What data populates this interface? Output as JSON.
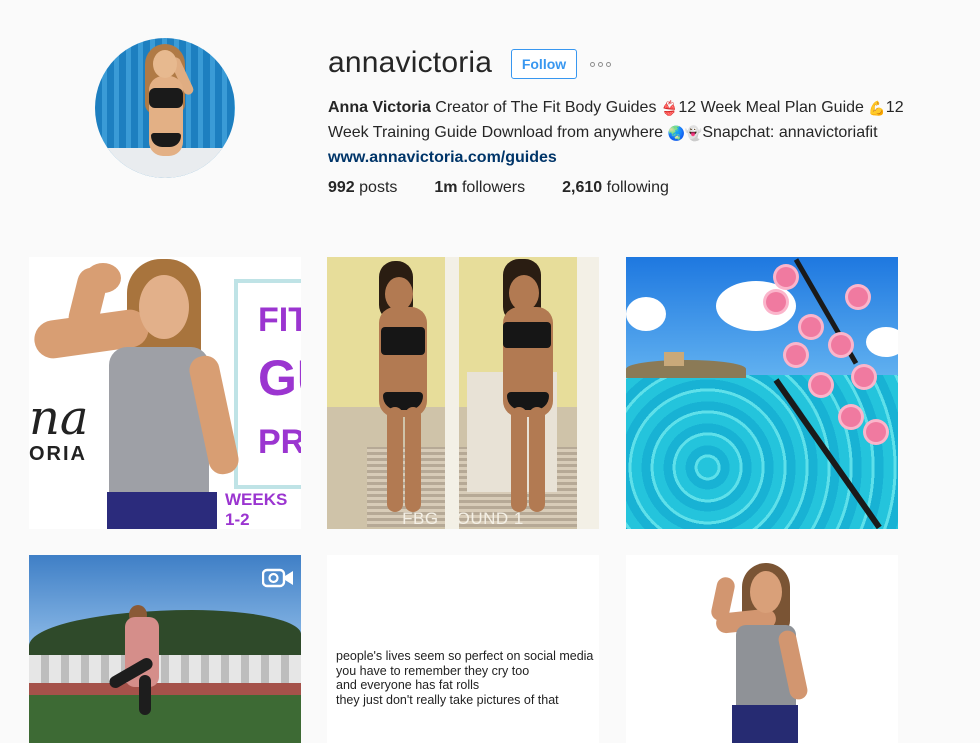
{
  "profile": {
    "username": "annavictoria",
    "follow_label": "Follow",
    "full_name": "Anna Victoria",
    "bio_part1": "Creator of The Fit Body Guides ",
    "emoji_bikini": "👙",
    "bio_part2": "12 Week Meal Plan Guide ",
    "emoji_muscle": "💪",
    "bio_part3": "12 Week Training Guide Download from anywhere ",
    "emoji_globe": "🌏",
    "emoji_ghost": "👻",
    "bio_part4": "Snapchat: annavictoriafit",
    "website": "www.annavictoria.com/guides"
  },
  "stats": {
    "posts_count": "992",
    "posts_label": "posts",
    "followers_count": "1m",
    "followers_label": "followers",
    "following_count": "2,610",
    "following_label": "following"
  },
  "posts": {
    "p1": {
      "fit": "FIT",
      "gu": "GU",
      "pre": "PRE",
      "weeks": "WEEKS 1-2",
      "logo_na": "na",
      "logo_oria": "ORIA"
    },
    "p2": {
      "caption": "FBG ROUND 1"
    },
    "p4": {
      "icon": "video-camera-icon"
    },
    "p5": {
      "lines": [
        "people's lives seem so perfect on social media",
        "you have to remember they cry too",
        "and everyone has fat rolls",
        "they just don't really take pictures of that"
      ]
    }
  },
  "colors": {
    "accent": "#3897f0",
    "link": "#003569",
    "text": "#262626",
    "background": "#fafafa",
    "guide_purple": "#9b35d0"
  }
}
